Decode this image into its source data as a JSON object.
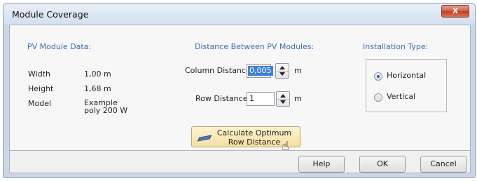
{
  "window": {
    "title": "Module Coverage",
    "close_label": "X"
  },
  "pv_module": {
    "header": "PV Module Data:",
    "rows": [
      {
        "label": "Width",
        "value": "1,00 m"
      },
      {
        "label": "Height",
        "value": "1,68 m"
      },
      {
        "label": "Model",
        "value": "Example poly 200 W"
      }
    ]
  },
  "distance": {
    "header": "Distance Between PV Modules:",
    "column_label": "Column Distance",
    "column_value": "0,005",
    "column_unit": "m",
    "row_label": "Row Distance",
    "row_value": "1",
    "row_unit": "m",
    "calculate_label": "Calculate Optimum Row Distance"
  },
  "installation": {
    "header": "Installation Type:",
    "options": [
      {
        "label": "Horizontal",
        "selected": true
      },
      {
        "label": "Vertical",
        "selected": false
      }
    ]
  },
  "buttons": {
    "help": "Help",
    "ok": "OK",
    "cancel": "Cancel"
  },
  "colors": {
    "header_text": "#3a6db7",
    "selection": "#3f7fdc",
    "close_button": "#c33c1f",
    "calc_button": "#f7dfa1"
  }
}
